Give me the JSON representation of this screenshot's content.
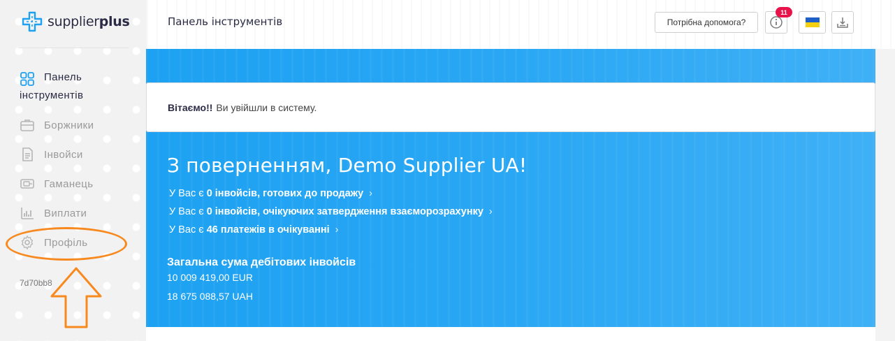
{
  "brand": {
    "name_light": "supplier",
    "name_bold": "plus",
    "accent": "#1da1f2"
  },
  "header": {
    "title": "Панель інструментів",
    "help_label": "Потрібна допомога?",
    "notification_count": "11"
  },
  "sidebar": {
    "items": [
      {
        "label": "Панель інструментів",
        "line1": "Панель",
        "line2": "інструментів",
        "icon": "dashboard-icon",
        "active": true
      },
      {
        "label": "Боржники",
        "icon": "briefcase-icon"
      },
      {
        "label": "Інвойси",
        "icon": "document-icon"
      },
      {
        "label": "Гаманець",
        "icon": "wallet-icon"
      },
      {
        "label": "Виплати",
        "icon": "bar-chart-icon"
      },
      {
        "label": "Профіль",
        "icon": "gear-icon"
      }
    ],
    "version": "7d70bb8"
  },
  "alert": {
    "strong": "Вітаємо!!",
    "text": "Ви увійшли в систему."
  },
  "main": {
    "welcome": "З поверненням, Demo Supplier UA!",
    "stats": [
      {
        "prefix": "У Вас є",
        "value": "0 інвойсів, готових до продажу"
      },
      {
        "prefix": "У Вас є",
        "value": "0 інвойсів, очікуючих затвердження взаєморозрахунку"
      },
      {
        "prefix": "У Вас є",
        "value": "46 платежів в очікуванні"
      }
    ],
    "total_title": "Загальна сума дебітових інвойсів",
    "totals": [
      "10 009 419,00 EUR",
      "18 675 088,57 UAH"
    ]
  },
  "colors": {
    "badge": "#e8134b",
    "annotation": "#f7891f",
    "banner": "#1da1f2"
  }
}
